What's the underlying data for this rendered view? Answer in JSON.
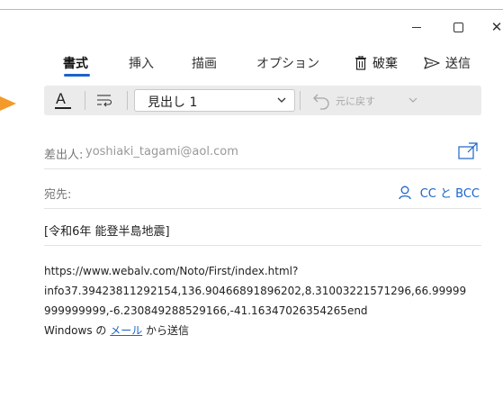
{
  "window": {
    "minimize": "−",
    "maximize": "□",
    "close": "✕"
  },
  "tabs": [
    {
      "label": "書式",
      "active": true
    },
    {
      "label": "挿入",
      "active": false
    },
    {
      "label": "描画",
      "active": false
    },
    {
      "label": "オプション",
      "active": false
    }
  ],
  "actions": {
    "discard_label": "破棄",
    "discard_icon": "trash-icon",
    "send_label": "送信",
    "send_icon": "send-icon"
  },
  "toolbar": {
    "font_color_letter": "A",
    "style_value": "見出し 1",
    "undo_label": "元に戻す"
  },
  "header": {
    "from_label": "差出人:",
    "from_value": "yoshiaki_tagami@aol.com",
    "to_label": "宛先:",
    "cc_bcc_label": "CC と BCC",
    "subject": "[令和6年 能登半島地震]"
  },
  "body": {
    "line1": "https://www.webalv.com/Noto/First/index.html?",
    "line2": "info37.39423811292154,136.90466891896202,8.31003221571296,66.99999",
    "line3": "999999999,-6.230849288529166,-41.16347026354265end",
    "footer_prefix": "Windows の ",
    "footer_link": "メール",
    "footer_suffix": " から送信"
  },
  "colors": {
    "accent": "#1a64c8",
    "toolbar_bg": "#ebebeb",
    "marker": "#f39a2b"
  }
}
